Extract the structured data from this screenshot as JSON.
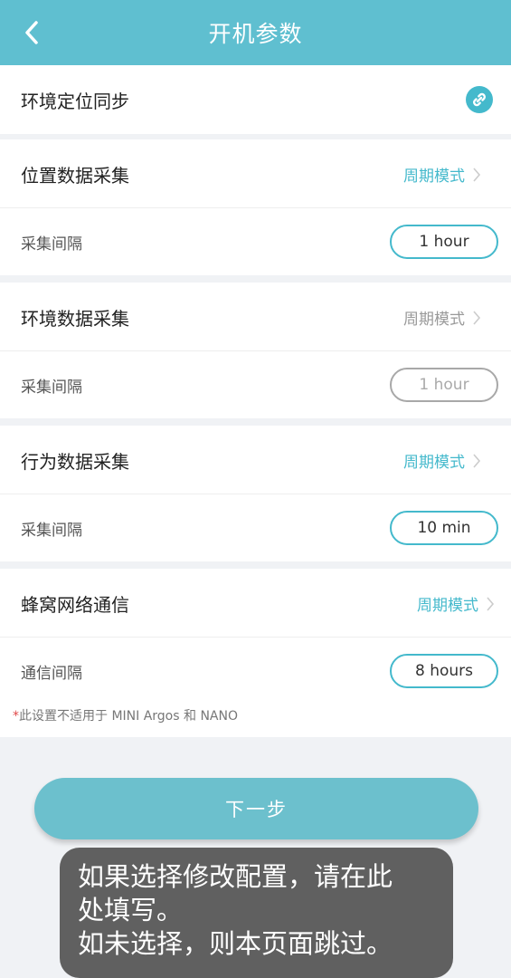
{
  "header": {
    "title": "开机参数"
  },
  "sync": {
    "label": "环境定位同步",
    "icon": "link-icon"
  },
  "sections": [
    {
      "title": "位置数据采集",
      "mode": "周期模式",
      "mode_active": true,
      "interval_label": "采集间隔",
      "interval_value": "1 hour",
      "interval_enabled": true
    },
    {
      "title": "环境数据采集",
      "mode": "周期模式",
      "mode_active": false,
      "interval_label": "采集间隔",
      "interval_value": "1 hour",
      "interval_enabled": false
    },
    {
      "title": "行为数据采集",
      "mode": "周期模式",
      "mode_active": true,
      "interval_label": "采集间隔",
      "interval_value": "10 min",
      "interval_enabled": true
    },
    {
      "title": "蜂窝网络通信",
      "mode": "周期模式",
      "mode_active": true,
      "interval_label": "通信间隔",
      "interval_value": "8 hours",
      "interval_enabled": true
    }
  ],
  "note": {
    "star": "*",
    "text": "此设置不适用于 MINI Argos 和 NANO"
  },
  "next_button": "下一步",
  "overlay": {
    "line1": "如果选择修改配置，请在此",
    "line2": "处填写。",
    "line3": "如未选择，则本页面跳过。"
  },
  "colors": {
    "accent": "#44b9cc",
    "header": "#5fbfd0",
    "button": "#6cc0cd"
  }
}
